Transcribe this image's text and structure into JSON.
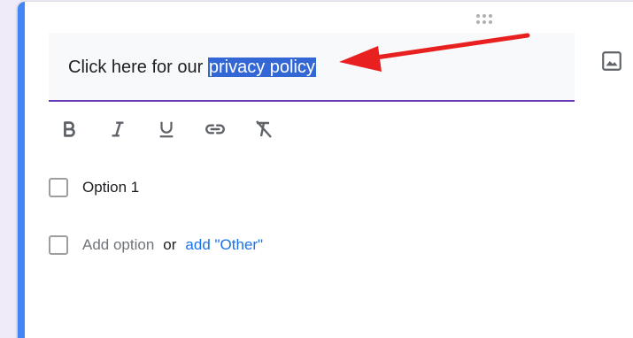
{
  "question": {
    "text_before": "Click here for our ",
    "selected_text": "privacy policy"
  },
  "toolbar": {
    "bold": "bold-icon",
    "italic": "italic-icon",
    "underline": "underline-icon",
    "link": "link-icon",
    "clear_formatting": "clear-formatting-icon"
  },
  "options": [
    {
      "label": "Option 1"
    }
  ],
  "add_option": {
    "label": "Add option",
    "or": "or",
    "add_other": "add \"Other\""
  },
  "colors": {
    "accent_bar": "#4285f4",
    "question_underline": "#673ab7",
    "selection": "#3367d6",
    "link": "#1a73e8",
    "annotation_arrow": "#e8201f"
  }
}
